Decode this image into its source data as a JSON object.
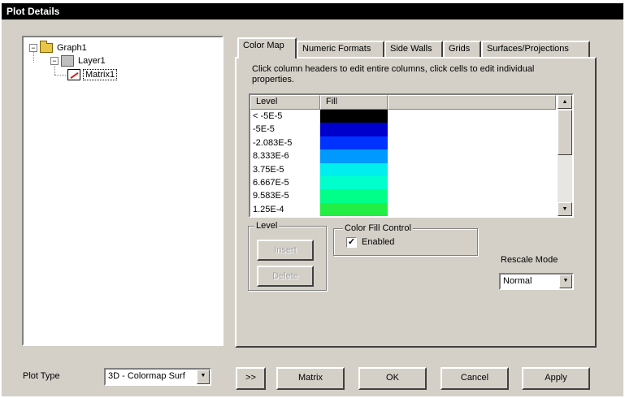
{
  "window": {
    "title": "Plot Details"
  },
  "tree": {
    "items": [
      {
        "label": "Graph1",
        "toggle": "−"
      },
      {
        "label": "Layer1",
        "toggle": "−"
      },
      {
        "label": "Matrix1"
      }
    ]
  },
  "tabs": [
    {
      "label": "Color Map",
      "active": true
    },
    {
      "label": "Numeric Formats"
    },
    {
      "label": "Side Walls"
    },
    {
      "label": "Grids"
    },
    {
      "label": "Surfaces/Projections"
    }
  ],
  "colormap": {
    "instructions": "Click column headers to edit entire columns, click cells to edit individual properties.",
    "columns": {
      "level": "Level",
      "fill": "Fill"
    },
    "rows": [
      {
        "level": "< -5E-5",
        "color": "#000000"
      },
      {
        "level": "-5E-5",
        "color": "#0000cc"
      },
      {
        "level": "-2.083E-5",
        "color": "#0033ff"
      },
      {
        "level": "8.333E-6",
        "color": "#0099ff"
      },
      {
        "level": "3.75E-5",
        "color": "#00eeee"
      },
      {
        "level": "6.667E-5",
        "color": "#00ffcc"
      },
      {
        "level": "9.583E-5",
        "color": "#00ff88"
      },
      {
        "level": "1.25E-4",
        "color": "#22ee44"
      }
    ],
    "level_group": {
      "title": "Level",
      "insert_label": "Insert",
      "delete_label": "Delete"
    },
    "fill_group": {
      "title": "Color Fill Control",
      "enabled_label": "Enabled",
      "enabled_checked": "✓"
    },
    "rescale": {
      "label": "Rescale Mode",
      "value": "Normal"
    }
  },
  "footer": {
    "plot_type_label": "Plot Type",
    "plot_type_value": "3D - Colormap Surf",
    "expand_label": ">>",
    "matrix_label": "Matrix",
    "ok_label": "OK",
    "cancel_label": "Cancel",
    "apply_label": "Apply"
  },
  "icons": {
    "tree-collapse": "minus-box",
    "graph": "folder-icon",
    "layer": "layer-icon",
    "matrix": "matrix-icon",
    "dropdown": "triangle-down",
    "scroll-up": "triangle-up",
    "scroll-down": "triangle-down"
  }
}
